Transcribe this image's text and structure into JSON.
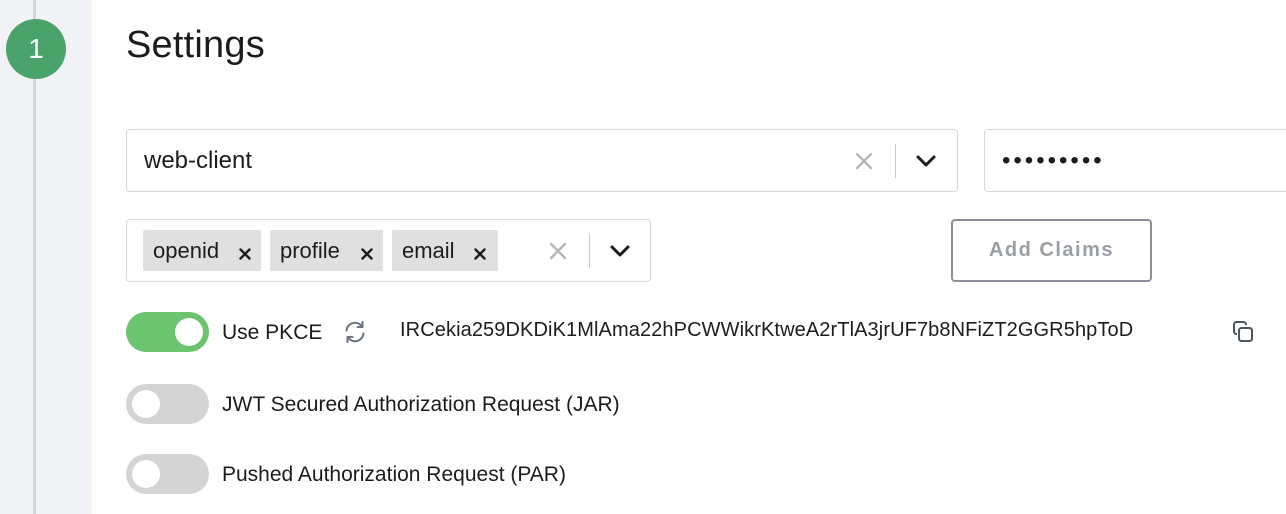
{
  "step": {
    "number": "1"
  },
  "page": {
    "title": "Settings"
  },
  "client": {
    "value": "web-client"
  },
  "secret": {
    "value": "•••••••••"
  },
  "scopes": {
    "items": [
      {
        "label": "openid"
      },
      {
        "label": "profile"
      },
      {
        "label": "email"
      }
    ]
  },
  "actions": {
    "add_claims_label": "Add Claims"
  },
  "pkce": {
    "label": "Use PKCE",
    "enabled": true,
    "code_verifier": "IRCekia259DKDiK1MlAma22hPCWWikrKtweA2rTlA3jrUF7b8NFiZT2GGR5hpToD"
  },
  "jar": {
    "label": "JWT Secured Authorization Request (JAR)",
    "enabled": false
  },
  "par": {
    "label": "Pushed Authorization Request (PAR)",
    "enabled": false
  },
  "icons": {
    "clear": "close-icon",
    "dropdown": "chevron-down-icon",
    "remove_chip": "close-icon",
    "regenerate": "refresh-icon",
    "copy": "copy-icon"
  },
  "colors": {
    "step_badge": "#4aa36a",
    "toggle_on": "#6cc46f",
    "toggle_off": "#d4d4d4",
    "chip_bg": "#e0e0e0"
  }
}
